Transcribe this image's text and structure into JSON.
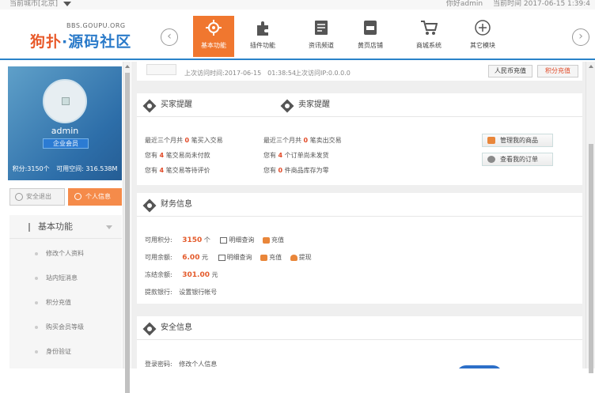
{
  "topbar": {
    "city_label": "当前城市[北京]",
    "welcome": "你好admin",
    "time": "当前时间 2017-06-15 1:39:4"
  },
  "header": {
    "logo_small": "BBS.GOUPU.ORG",
    "logo_main_a": "狗扑",
    "logo_main_b": "·源码社区",
    "nav": [
      {
        "label": "基本功能",
        "icon": "gear-icon"
      },
      {
        "label": "插件功能",
        "icon": "puzzle-icon"
      },
      {
        "label": "资讯频道",
        "icon": "document-icon"
      },
      {
        "label": "黄页店铺",
        "icon": "shop-icon"
      },
      {
        "label": "商城系统",
        "icon": "cart-icon"
      },
      {
        "label": "其它模块",
        "icon": "plus-circle-icon"
      }
    ]
  },
  "profile": {
    "name": "admin",
    "badge": "企业会员",
    "points": "积分:3150个",
    "space": "可用空间: 316.538M"
  },
  "buttons": {
    "logout": "安全退出",
    "info": "个人信息"
  },
  "menu": {
    "title": "基本功能",
    "items": [
      "修改个人资料",
      "站内短消息",
      "积分充值",
      "购买会员等级",
      "身份验证"
    ]
  },
  "top_strip": {
    "last_visit_time": "上次访问时间:2017-06-15　01:38:54",
    "last_visit_ip": "上次访问IP:0.0.0.0",
    "btn_rmb": "人民币充值",
    "btn_points": "积分充值"
  },
  "trade": {
    "buyer_title": "买家提醒",
    "seller_title": "卖家提醒",
    "buyer_lines": [
      {
        "pre": "最近三个月共",
        "num": "0",
        "post": "笔买入交易"
      },
      {
        "pre": "您有",
        "num": "4",
        "post": "笔交易尚未付款"
      },
      {
        "pre": "您有",
        "num": "4",
        "post": "笔交易等待评价"
      }
    ],
    "seller_lines": [
      {
        "pre": "最近三个月共",
        "num": "0",
        "post": "笔卖出交易"
      },
      {
        "pre": "您有",
        "num": "4",
        "post": "个订单尚未发货"
      },
      {
        "pre": "您有",
        "num": "0",
        "post": "件商品库存为零"
      }
    ],
    "btn_manage": "管理我的商品",
    "btn_orders": "查看我的订单"
  },
  "finance": {
    "title": "财务信息",
    "points_label": "可用积分:",
    "points_value": "3150",
    "points_unit": "个",
    "balance_label": "可用余额:",
    "balance_value": "6.00",
    "balance_unit": "元",
    "frozen_label": "冻结余额:",
    "frozen_value": "301.00",
    "frozen_unit": "元",
    "bank_label": "提款银行:",
    "bank_link": "设置银行帐号",
    "link_detail": "明细查询",
    "link_recharge": "充值",
    "link_withdraw": "提现"
  },
  "security": {
    "title": "安全信息",
    "login_pwd_label": "登录密码:",
    "login_pwd_link": "修改个人信息"
  },
  "colors": {
    "accent_orange": "#f0772f",
    "brand_blue": "#2a83c9",
    "value_red": "#e24a27"
  }
}
